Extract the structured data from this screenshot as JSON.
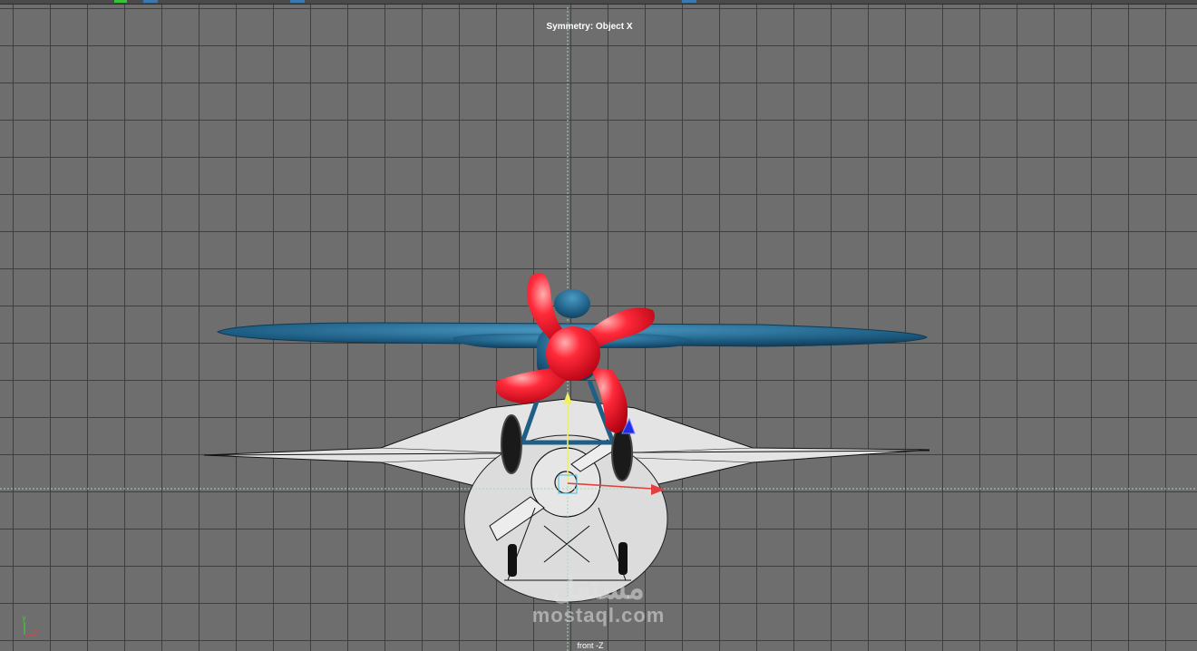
{
  "viewport": {
    "symmetry_label": "Symmetry: Object X",
    "camera_label": "front -Z"
  },
  "axis_indicator": {
    "y_label": "y",
    "x_label": "x"
  },
  "watermark": {
    "arabic": "مستقل",
    "latin": "mostaql.com"
  },
  "colors": {
    "grid_bg": "#6e6e6e",
    "grid_line": "#3f3f3f",
    "fuselage_blue": "#1f5f85",
    "propeller_red": "#e8182a",
    "reference_white": "#e8e8e8",
    "axis_green": "#37d337",
    "axis_red": "#e04040",
    "manip_blue": "#2030e0",
    "manip_yellow": "#f0f060"
  },
  "icons": [
    "move-manipulator-icon",
    "axis-indicator-icon",
    "pivot-icon"
  ]
}
